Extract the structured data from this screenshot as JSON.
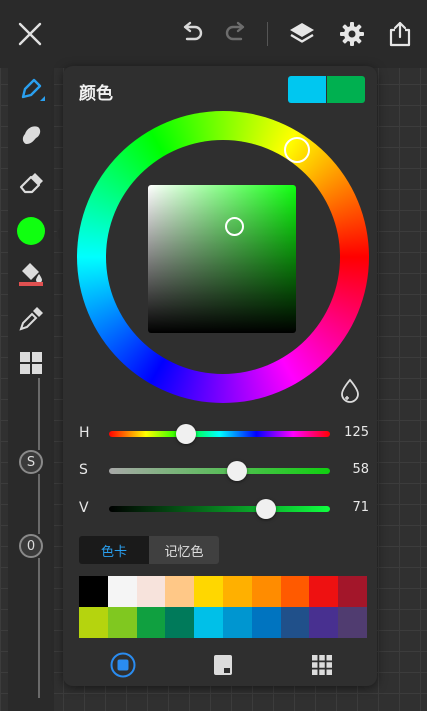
{
  "topbar": {
    "icons": [
      "close-icon",
      "undo-icon",
      "redo-icon",
      "layers-icon",
      "settings-icon",
      "share-icon"
    ]
  },
  "sidebar": {
    "tools": [
      "pen-icon",
      "smudge-icon",
      "eraser-icon",
      "color-icon",
      "fill-bucket-icon",
      "eyedropper-icon",
      "grid-icon"
    ],
    "size_label": "S",
    "opacity_label": "0",
    "active_color": "#10ff10"
  },
  "color_panel": {
    "title": "颜色",
    "current_color": "#00c7f0",
    "previous_color": "#00b050",
    "hsv": {
      "h_label": "H",
      "h_value": "125",
      "h_fraction": 0.347,
      "s_label": "S",
      "s_value": "58",
      "s_fraction": 0.58,
      "v_label": "V",
      "v_value": "71",
      "v_fraction": 0.71
    },
    "tabs": [
      {
        "label": "色卡",
        "active": true
      },
      {
        "label": "记忆色",
        "active": false
      }
    ],
    "palette": [
      "#000000",
      "#f5f5f5",
      "#f7e3dc",
      "#ffc887",
      "#ffd700",
      "#ffb000",
      "#ff8c00",
      "#ff5a00",
      "#ee1111",
      "#a3162a",
      "#b5d40e",
      "#80c820",
      "#10a040",
      "#007a5a",
      "#00c0e8",
      "#0096d0",
      "#0074c0",
      "#20508a",
      "#483090",
      "#503c70"
    ],
    "bottom_icons": [
      "palette-square-icon",
      "swatch-card-icon",
      "grid-palette-icon"
    ]
  }
}
